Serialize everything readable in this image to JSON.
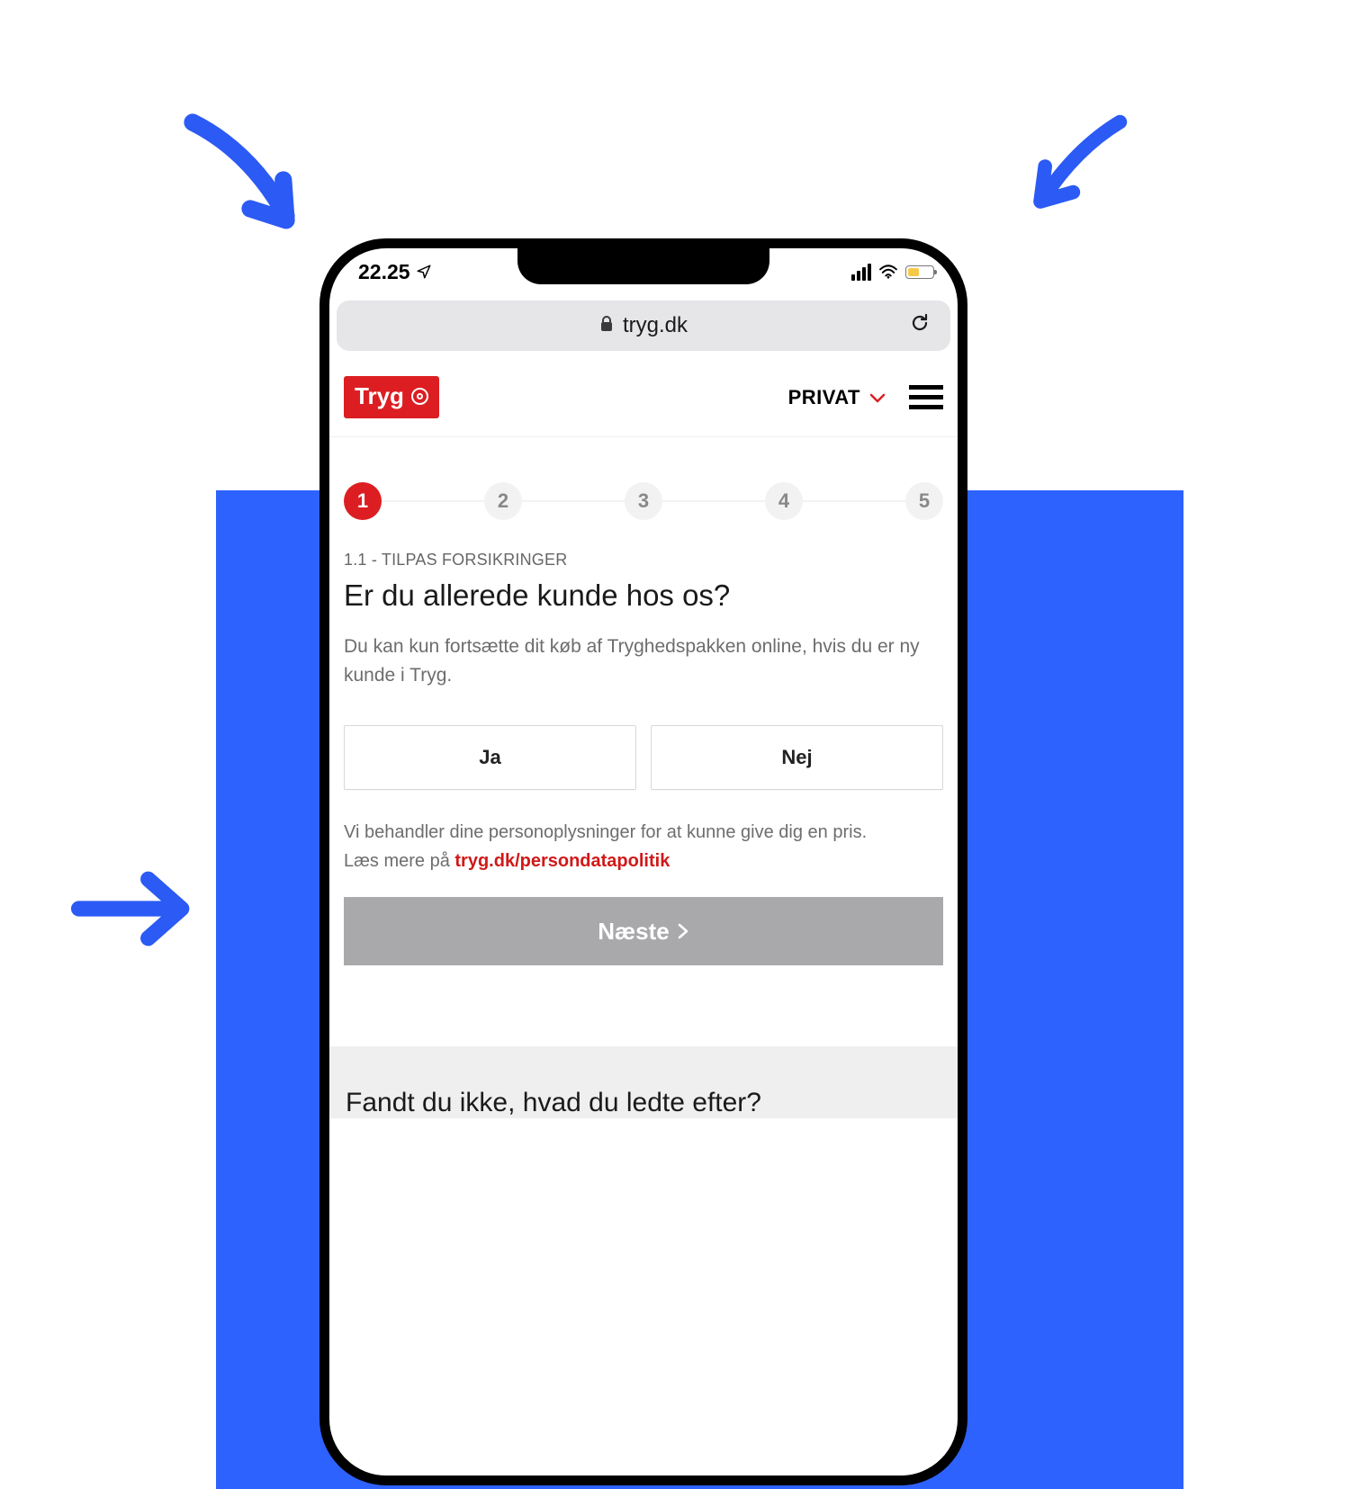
{
  "status": {
    "time": "22.25"
  },
  "browser": {
    "domain": "tryg.dk"
  },
  "header": {
    "brand": "Tryg",
    "nav_label": "PRIVAT"
  },
  "stepper": {
    "steps": [
      "1",
      "2",
      "3",
      "4",
      "5"
    ],
    "active_index": 0
  },
  "page": {
    "kicker": "1.1  -  TILPAS FORSIKRINGER",
    "title": "Er du allerede kunde hos os?",
    "lead": "Du kan kun fortsætte dit køb af Tryghedspakken online, hvis du er ny kunde i Tryg.",
    "option_yes": "Ja",
    "option_no": "Nej",
    "disclaimer_line1": "Vi behandler dine personoplysninger for at kunne give dig en pris.",
    "disclaimer_line2_prefix": "Læs mere på ",
    "disclaimer_link": "tryg.dk/persondatapolitik",
    "next_label": "Næste"
  },
  "footer": {
    "heading": "Fandt du ikke, hvad du ledte efter?"
  }
}
